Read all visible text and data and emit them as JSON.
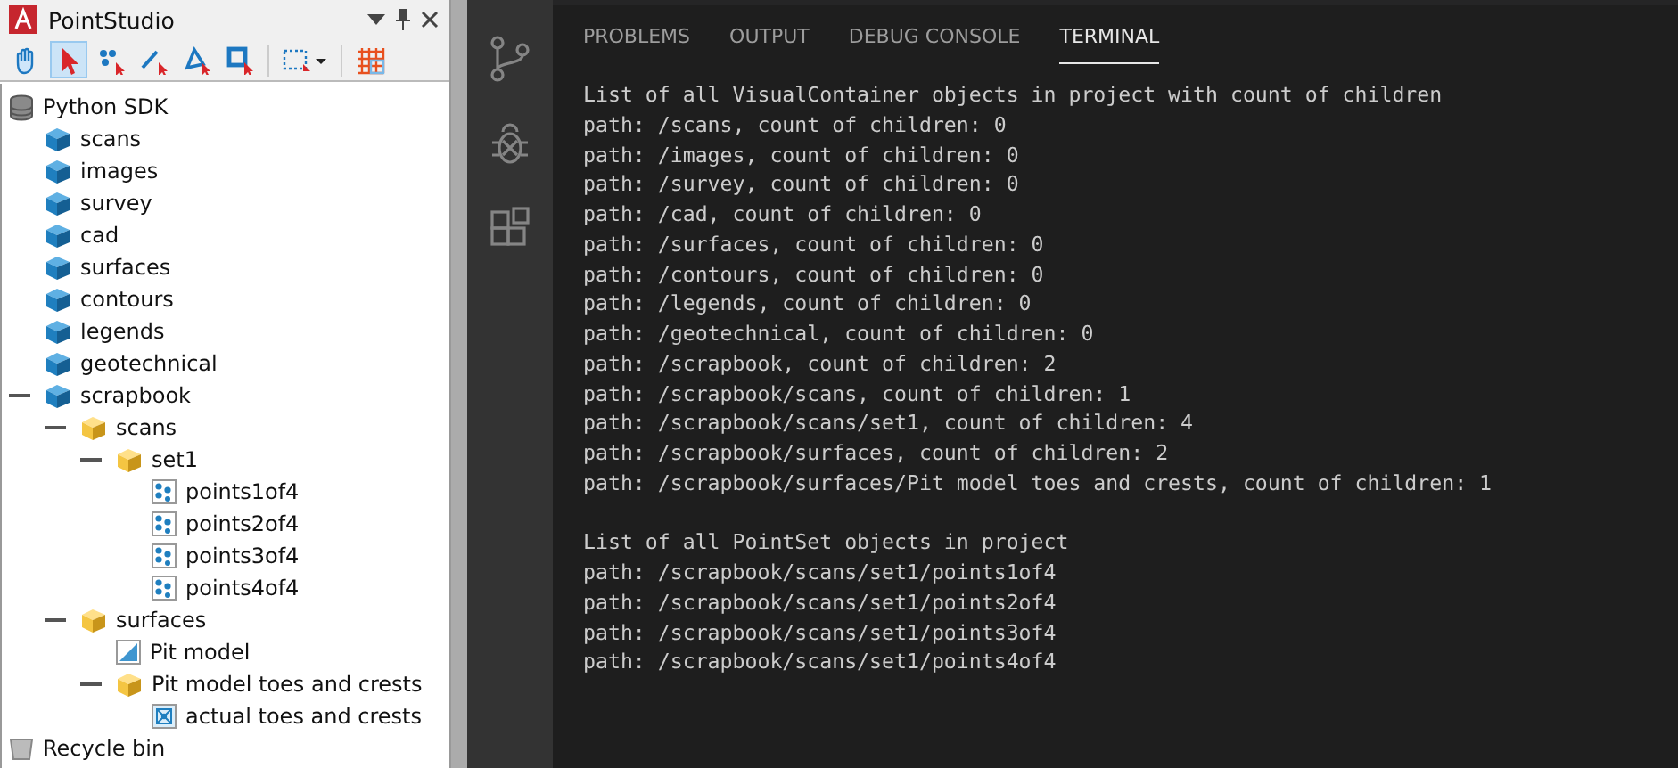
{
  "panel": {
    "title": "PointStudio"
  },
  "tools": [
    {
      "kind": "hand",
      "selected": false
    },
    {
      "kind": "select",
      "selected": true
    },
    {
      "kind": "points",
      "selected": false
    },
    {
      "kind": "line",
      "selected": false
    },
    {
      "kind": "polygon",
      "selected": false
    },
    {
      "kind": "rect",
      "selected": false
    },
    {
      "kind": "marquee",
      "selected": false
    },
    {
      "kind": "grid",
      "selected": false
    }
  ],
  "tree": [
    {
      "label": "Python SDK",
      "kind": "database",
      "children": [
        {
          "label": "scans",
          "kind": "container"
        },
        {
          "label": "images",
          "kind": "container"
        },
        {
          "label": "survey",
          "kind": "container"
        },
        {
          "label": "cad",
          "kind": "container"
        },
        {
          "label": "surfaces",
          "kind": "container"
        },
        {
          "label": "contours",
          "kind": "container"
        },
        {
          "label": "legends",
          "kind": "container"
        },
        {
          "label": "geotechnical",
          "kind": "container"
        },
        {
          "label": "scrapbook",
          "kind": "container",
          "expanded": true,
          "children": [
            {
              "label": "scans",
              "kind": "folder",
              "expanded": true,
              "children": [
                {
                  "label": "set1",
                  "kind": "folder",
                  "expanded": true,
                  "children": [
                    {
                      "label": "points1of4",
                      "kind": "points"
                    },
                    {
                      "label": "points2of4",
                      "kind": "points"
                    },
                    {
                      "label": "points3of4",
                      "kind": "points"
                    },
                    {
                      "label": "points4of4",
                      "kind": "points"
                    }
                  ]
                }
              ]
            },
            {
              "label": "surfaces",
              "kind": "folder",
              "expanded": true,
              "children": [
                {
                  "label": "Pit model",
                  "kind": "surface"
                },
                {
                  "label": "Pit model toes and crests",
                  "kind": "folder",
                  "expanded": true,
                  "children": [
                    {
                      "label": "actual toes and crests",
                      "kind": "edges"
                    }
                  ]
                }
              ]
            }
          ]
        }
      ]
    },
    {
      "label": "Recycle bin",
      "kind": "recycle"
    }
  ],
  "terminal": {
    "tabs": [
      {
        "label": "PROBLEMS",
        "selected": false
      },
      {
        "label": "OUTPUT",
        "selected": false
      },
      {
        "label": "DEBUG CONSOLE",
        "selected": false
      },
      {
        "label": "TERMINAL",
        "selected": true
      }
    ],
    "blocks": [
      {
        "lines": [
          "List of all VisualContainer objects in project with count of children",
          "path: /scans, count of children: 0",
          "path: /images, count of children: 0",
          "path: /survey, count of children: 0",
          "path: /cad, count of children: 0",
          "path: /surfaces, count of children: 0",
          "path: /contours, count of children: 0",
          "path: /legends, count of children: 0",
          "path: /geotechnical, count of children: 0",
          "path: /scrapbook, count of children: 2",
          "path: /scrapbook/scans, count of children: 1",
          "path: /scrapbook/scans/set1, count of children: 4",
          "path: /scrapbook/surfaces, count of children: 2",
          "path: /scrapbook/surfaces/Pit model toes and crests, count of children: 1"
        ]
      },
      {
        "lines": [
          "List of all PointSet objects in project",
          "path: /scrapbook/scans/set1/points1of4",
          "path: /scrapbook/scans/set1/points2of4",
          "path: /scrapbook/scans/set1/points3of4",
          "path: /scrapbook/scans/set1/points4of4"
        ]
      }
    ]
  }
}
